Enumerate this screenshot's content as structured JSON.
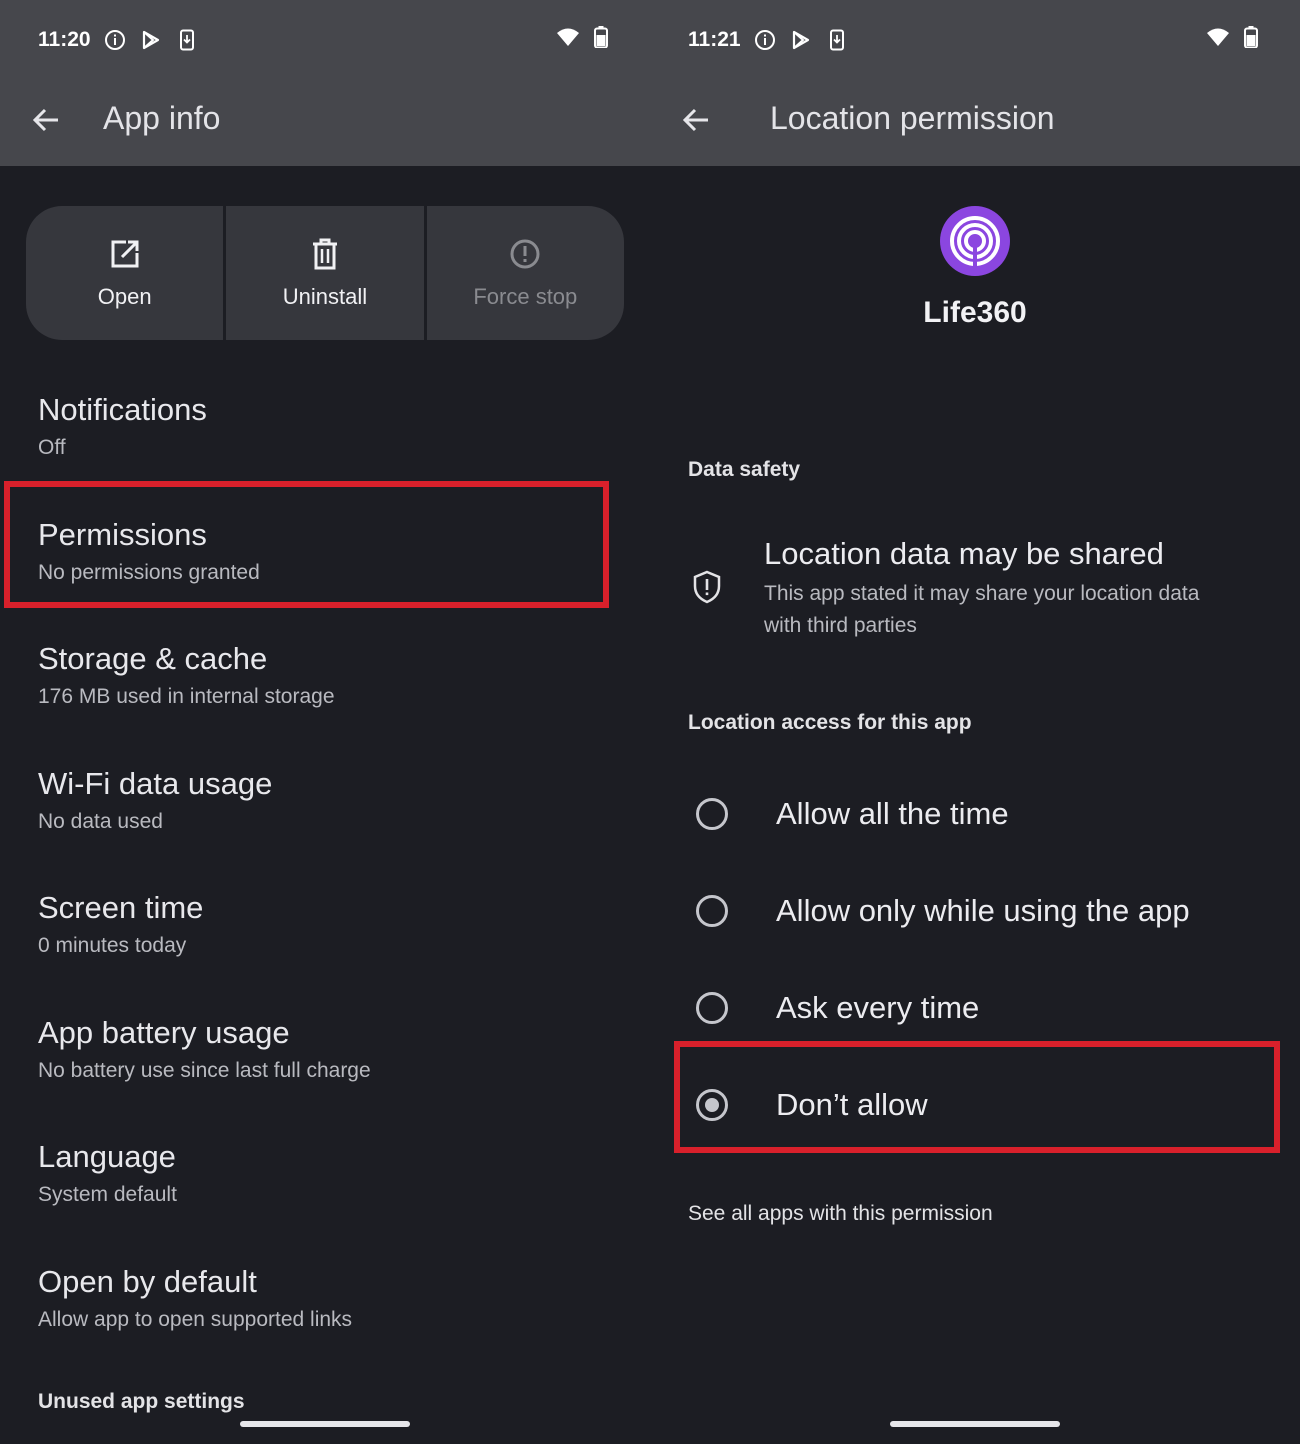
{
  "left": {
    "status": {
      "time": "11:20"
    },
    "toolbar": {
      "title": "App info"
    },
    "actions": [
      {
        "label": "Open",
        "icon": "open-external-icon"
      },
      {
        "label": "Uninstall",
        "icon": "trash-icon"
      },
      {
        "label": "Force stop",
        "icon": "alert-circle-icon"
      }
    ],
    "items": [
      {
        "title": "Notifications",
        "sub": "Off"
      },
      {
        "title": "Permissions",
        "sub": "No permissions granted"
      },
      {
        "title": "Storage & cache",
        "sub": "176 MB used in internal storage"
      },
      {
        "title": "Wi-Fi data usage",
        "sub": "No data used"
      },
      {
        "title": "Screen time",
        "sub": "0 minutes today"
      },
      {
        "title": "App battery usage",
        "sub": "No battery use since last full charge"
      },
      {
        "title": "Language",
        "sub": "System default"
      },
      {
        "title": "Open by default",
        "sub": "Allow app to open supported links"
      }
    ],
    "section_unused": "Unused app settings"
  },
  "right": {
    "status": {
      "time": "11:21"
    },
    "toolbar": {
      "title": "Location permission"
    },
    "app_name": "Life360",
    "data_safety": {
      "header": "Data safety",
      "title": "Location data may be shared",
      "sub_line1": "This app stated it may share your location data",
      "sub_line2": "with third parties"
    },
    "access_header": "Location access for this app",
    "options": [
      {
        "label": "Allow all the time",
        "checked": false
      },
      {
        "label": "Allow only while using the app",
        "checked": false
      },
      {
        "label": "Ask every time",
        "checked": false
      },
      {
        "label": "Don’t allow",
        "checked": true
      }
    ],
    "see_all": "See all apps with this permission"
  },
  "colors": {
    "background": "#1c1d23",
    "topbar": "#46474c",
    "highlight": "#d8202b",
    "app_icon": "#8b46e0"
  }
}
